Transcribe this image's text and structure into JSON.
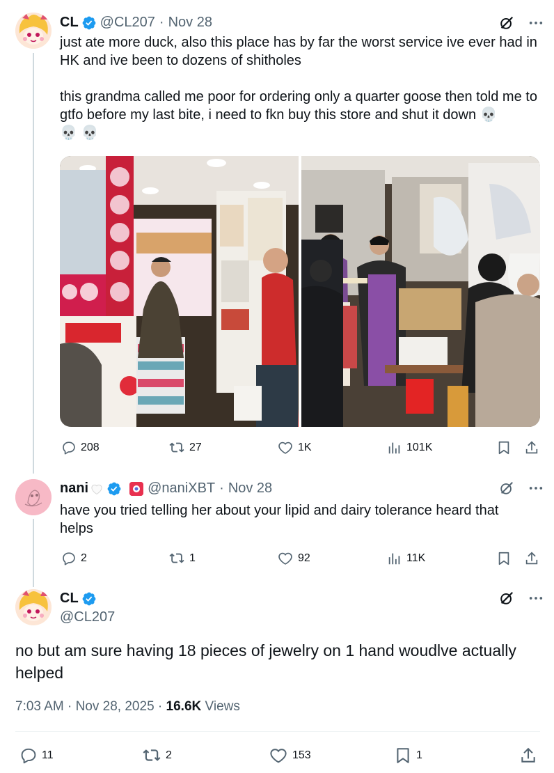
{
  "tweet1": {
    "name": "CL",
    "handle": "@CL207",
    "sep": "·",
    "date": "Nov 28",
    "para1": "just ate more duck, also this place has by far the worst service ive ever had in HK and ive been to dozens of shitholes",
    "para2": "this grandma called me poor for ordering only a quarter goose then told me to gtfo before my last bite, i need to fkn buy this store and shut it down",
    "emoji_skull": "💀",
    "stats": {
      "replies": "208",
      "reposts": "27",
      "likes": "1K",
      "views": "101K"
    }
  },
  "tweet2": {
    "name": "nani",
    "handle": "@naniXBT",
    "sep": "·",
    "date": "Nov 28",
    "text": "have you tried telling her about your lipid and dairy tolerance heard that helps",
    "stats": {
      "replies": "2",
      "reposts": "1",
      "likes": "92",
      "views": "11K"
    }
  },
  "tweet3": {
    "name": "CL",
    "handle": "@CL207",
    "text": "no but am sure having 18 pieces of jewelry on 1 hand woudlve actually helped",
    "time": "7:03 AM",
    "sep": "·",
    "date": "Nov 28, 2025",
    "views_count": "16.6K",
    "views_label": "Views",
    "stats": {
      "replies": "11",
      "reposts": "2",
      "likes": "153",
      "bookmarks": "1"
    }
  },
  "colors": {
    "verified": "#1d9bf0",
    "muted": "#536471",
    "text": "#0f1419",
    "thread_line": "#cfd9de"
  },
  "icons": [
    "verified-badge-icon",
    "grok-icon",
    "more-icon",
    "reply-icon",
    "repost-icon",
    "like-icon",
    "views-icon",
    "bookmark-icon",
    "share-icon",
    "skull-emoji",
    "white-heart-emoji"
  ]
}
